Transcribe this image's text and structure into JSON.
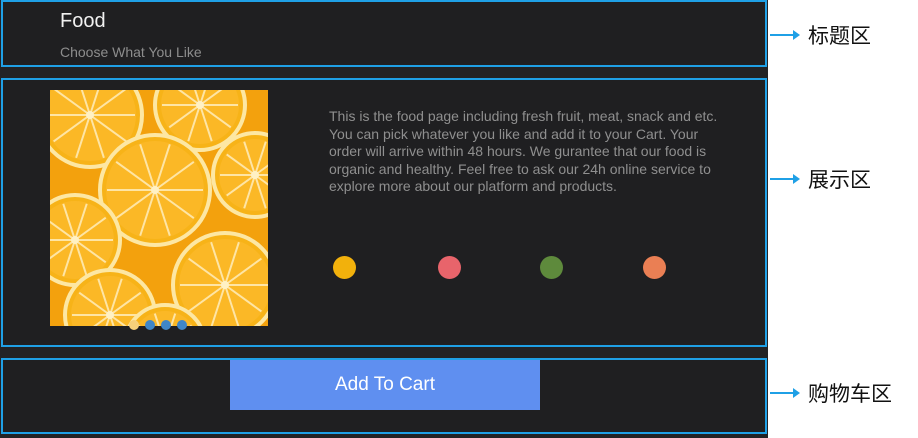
{
  "header": {
    "title": "Food",
    "subtitle": "Choose What You Like"
  },
  "display": {
    "description": "This is the food page including fresh fruit, meat, snack and etc. You can pick whatever you like and add it to your Cart. Your order will arrive within 48 hours. We gurantee that our food is organic and healthy. Feel free to ask our 24h online service to explore more about our platform and products.",
    "carousel_dots": [
      "#f6d07a",
      "#3f86c7",
      "#3f86c7",
      "#3f86c7"
    ],
    "color_options": [
      "#f2b10c",
      "#e8646b",
      "#5e8a3c",
      "#ea7f54"
    ],
    "image_icon": "orange-slices-photo"
  },
  "cart": {
    "button_label": "Add To Cart"
  },
  "annotations": {
    "title_area": "标题区",
    "display_area": "展示区",
    "cart_area": "购物车区"
  },
  "colors": {
    "section_border": "#1fa0e6",
    "background": "#1f1f21",
    "button": "#5f8ff0"
  }
}
